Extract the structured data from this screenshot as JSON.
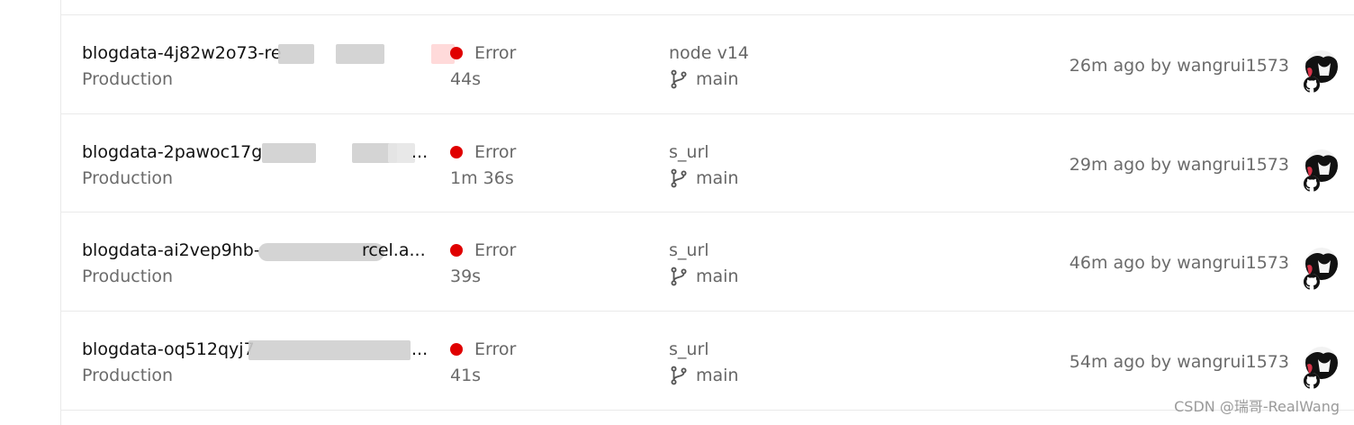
{
  "deployments": [
    {
      "name": "blogdata-4j82w2o73-re",
      "environment": "Production",
      "status": "Error",
      "duration": "44s",
      "commit_message": "node v14",
      "branch": "main",
      "time_by": "26m ago by wangrui1573"
    },
    {
      "name": "blogdata-2pawoc17g",
      "name_tail": "...",
      "environment": "Production",
      "status": "Error",
      "duration": "1m 36s",
      "commit_message": "s_url",
      "branch": "main",
      "time_by": "29m ago by wangrui1573"
    },
    {
      "name": "blogdata-ai2vep9hb-",
      "name_tail": "rcel.a...",
      "environment": "Production",
      "status": "Error",
      "duration": "39s",
      "commit_message": "s_url",
      "branch": "main",
      "time_by": "46m ago by wangrui1573"
    },
    {
      "name": "blogdata-oq512qyj7",
      "name_tail": "...",
      "environment": "Production",
      "status": "Error",
      "duration": "41s",
      "commit_message": "s_url",
      "branch": "main",
      "time_by": "54m ago by wangrui1573"
    }
  ],
  "status_color": "#e00000",
  "watermark": "CSDN @瑞哥-RealWang",
  "icons": {
    "status": "status-dot-icon",
    "branch": "git-branch-icon",
    "avatar": "user-avatar",
    "provider": "github-icon"
  }
}
